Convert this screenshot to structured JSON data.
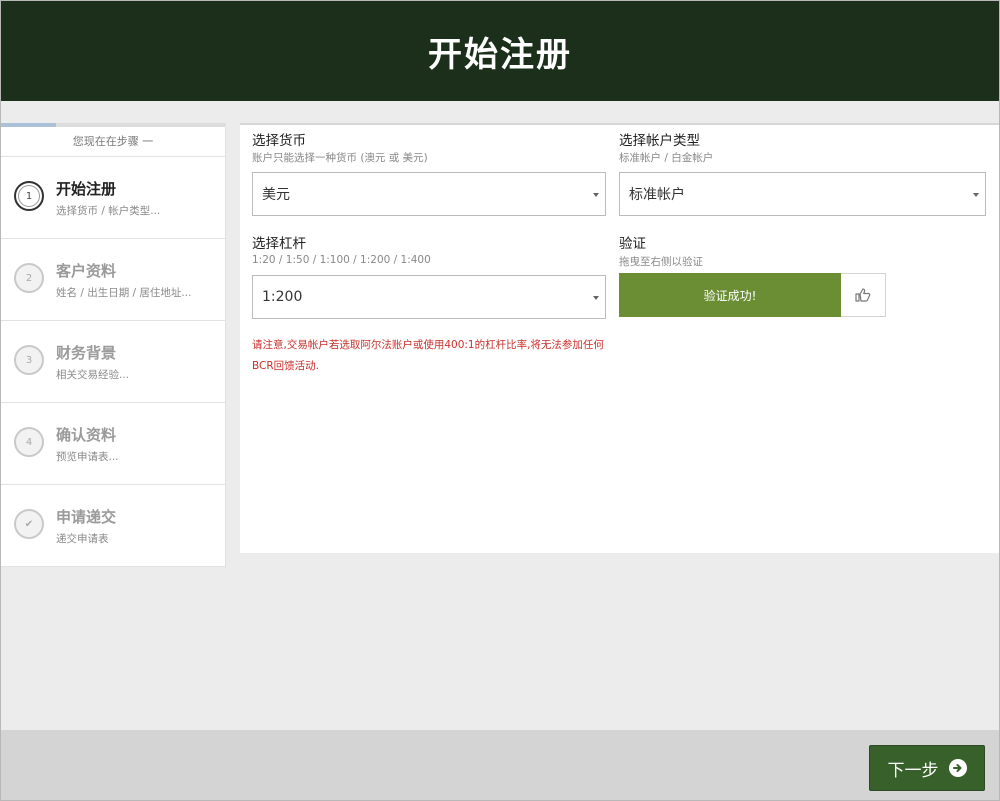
{
  "header": {
    "title": "开始注册"
  },
  "sidebar": {
    "current_step_label": "您现在在步骤 一",
    "steps": [
      {
        "number": "1",
        "title": "开始注册",
        "sub": "选择货币 / 帐户类型...",
        "active": true
      },
      {
        "number": "2",
        "title": "客户资料",
        "sub": "姓名 / 出生日期 / 居住地址..."
      },
      {
        "number": "3",
        "title": "财务背景",
        "sub": "相关交易经验..."
      },
      {
        "number": "4",
        "title": "确认资料",
        "sub": "预览申请表..."
      },
      {
        "number": "✔",
        "title": "申请递交",
        "sub": "递交申请表"
      }
    ]
  },
  "form": {
    "currency": {
      "title": "选择货币",
      "hint": "账户只能选择一种货币 (澳元 或 美元)",
      "value": "美元"
    },
    "account_type": {
      "title": "选择帐户类型",
      "hint": "标准帐户 / 白金帐户",
      "value": "标准帐户"
    },
    "leverage": {
      "title": "选择杠杆",
      "hint": "1:20 / 1:50 / 1:100 / 1:200 / 1:400",
      "value": "1:200"
    },
    "verify": {
      "title": "验证",
      "hint": "拖曳至右侧以验证",
      "status": "验证成功!"
    },
    "notice_line1": "请注意,交易帐户若选取阿尔法账户或使用400:1的杠杆比率,将无法参加任何",
    "notice_line2": "BCR回馈活动."
  },
  "footer": {
    "next_label": "下一步"
  },
  "colors": {
    "header_bg": "#1b2f1b",
    "verify_success": "#6b8e34",
    "next_button": "#38602b",
    "notice_text": "#c9302c"
  },
  "icons": {
    "verify_handle": "thumbs-up-icon",
    "next_arrow": "arrow-circle-right-icon",
    "select_caret": "caret-down-icon",
    "step_complete": "check-icon"
  }
}
